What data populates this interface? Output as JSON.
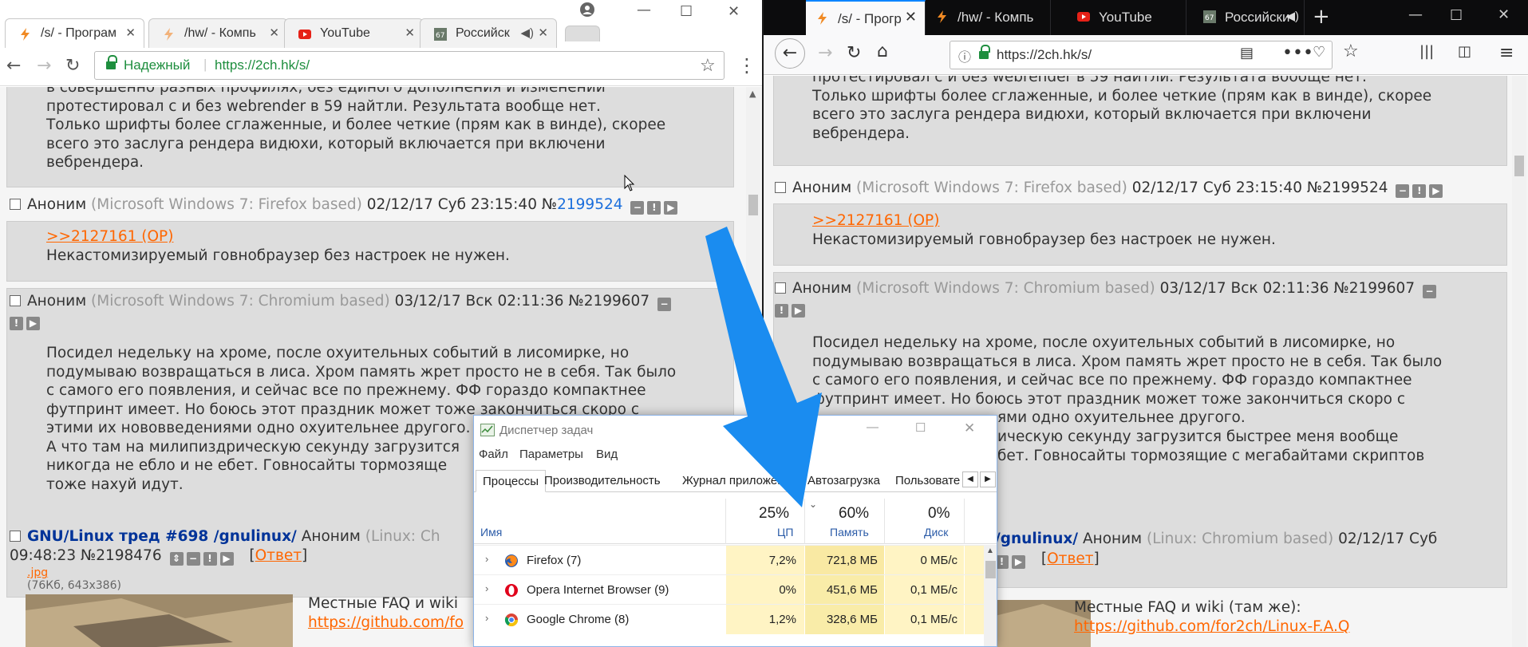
{
  "colors": {
    "reply_link": "#ff6600",
    "number_link": "#1a6edc",
    "arrow": "#1a8cf0",
    "chrome_secure": "#1e8e3e"
  },
  "chrome": {
    "tabs": [
      {
        "label": "/s/ - Програм",
        "icon": "bolt-icon"
      },
      {
        "label": "/hw/ - Компь",
        "icon": "bolt-icon"
      },
      {
        "label": "YouTube",
        "icon": "youtube-icon"
      },
      {
        "label": "Российск",
        "icon": "site-67-icon"
      }
    ],
    "secure_label": "Надежный",
    "url": "https://2ch.hk/s/"
  },
  "firefox": {
    "tabs": [
      {
        "label": "/s/ - Прогр",
        "icon": "bolt-icon"
      },
      {
        "label": "/hw/ - Компь",
        "icon": "bolt-icon"
      },
      {
        "label": "YouTube",
        "icon": "youtube-icon"
      },
      {
        "label": "Российски",
        "icon": "site-67-icon"
      }
    ],
    "url": "https://2ch.hk/s/"
  },
  "posts": {
    "p0": {
      "lines": [
        "в совершенно разных профилях, без единого дополнения и изменений",
        "протестировал с и без webrender в 59 найтли. Результата вообще нет.",
        "Только шрифты более сглаженные, и более четкие (прям как в винде), скорее",
        "всего это заслуга рендера видюхи, который включается при включени",
        "вебрендера."
      ]
    },
    "p1": {
      "name": "Аноним",
      "os": "(Microsoft Windows 7: Firefox based)",
      "date": "02/12/17 Суб 23:15:40",
      "num_prefix": "№",
      "num": "2199524",
      "full_num": "№2199524",
      "reply": ">>2127161 (OP)",
      "text": "Некастомизируемый говнобраузер без настроек не нужен."
    },
    "p2": {
      "name": "Аноним",
      "os": "(Microsoft Windows 7: Chromium based)",
      "date": "03/12/17 Вск 02:11:36",
      "num": "№2199607",
      "lines_chrome": [
        "Посидел недельку на хроме, после охуительных событий в лисомирке, но",
        "подумываю возвращаться в лиса. Хром память жрет просто не в себя. Так было",
        "с самого его появления, и сейчас все по прежнему. ФФ гораздо компактнее",
        "футпринт имеет. Но боюсь этот праздник может тоже закончиться скоро с",
        "этими их нововведениями одно охуительнее другого.",
        "А что там на милипиздрическую секунду загрузится",
        "никогда не ебло и не ебет. Говносайты тормозяще",
        "тоже нахуй идут."
      ],
      "lines_ff": [
        "Посидел недельку на хроме, после охуительных событий в лисомирке, но",
        "подумываю возвращаться в лиса. Хром память жрет просто не в себя. Так было",
        "с самого его появления, и сейчас все по прежнему. ФФ гораздо компактнее",
        "футпринт имеет. Но боюсь этот праздник может тоже закончиться скоро с",
        "ями одно охуительнее другого.",
        "ическую секунду загрузится быстрее меня вообще",
        "бет. Говносайты тормозящие с мегабайтами скриптов"
      ]
    },
    "thread": {
      "title": "GNU/Linux тред #698 /gnulinux/",
      "title_ff": "/gnulinux/",
      "name": "Аноним",
      "os_chrome": "(Linux: Ch",
      "os_ff": "(Linux: Chromium based)",
      "date_chrome": "09:48:23 №2198476",
      "date_ff": "02/12/17 Суб",
      "reply_label": "Ответ",
      "file_name": ".jpg",
      "file_info": "(76Кб, 643x386)",
      "text": "Местные FAQ и wiki",
      "text_ff": "Местные FAQ и wiki (там же):",
      "link_chrome": "https://github.com/fo",
      "link_ff": "https://github.com/for2ch/Linux-F.A.Q"
    }
  },
  "taskmgr": {
    "title": "Диспетчер задач",
    "menu": [
      "Файл",
      "Параметры",
      "Вид"
    ],
    "tabs": [
      "Процессы",
      "Производительность",
      "Журнал приложени",
      "Автозагрузка",
      "Пользовате"
    ],
    "columns": {
      "name": "Имя",
      "cpu": {
        "pct": "25%",
        "label": "ЦП"
      },
      "mem": {
        "pct": "60%",
        "label": "Память"
      },
      "disk": {
        "pct": "0%",
        "label": "Диск"
      }
    },
    "rows": [
      {
        "name": "Firefox (7)",
        "cpu": "7,2%",
        "mem": "721,8 МБ",
        "disk": "0 МБ/с",
        "icon": "firefox-icon"
      },
      {
        "name": "Opera Internet Browser (9)",
        "cpu": "0%",
        "mem": "451,6 МБ",
        "disk": "0,1 МБ/с",
        "icon": "opera-icon"
      },
      {
        "name": "Google Chrome (8)",
        "cpu": "1,2%",
        "mem": "328,6 МБ",
        "disk": "0,1 МБ/с",
        "icon": "chrome-icon"
      }
    ]
  }
}
